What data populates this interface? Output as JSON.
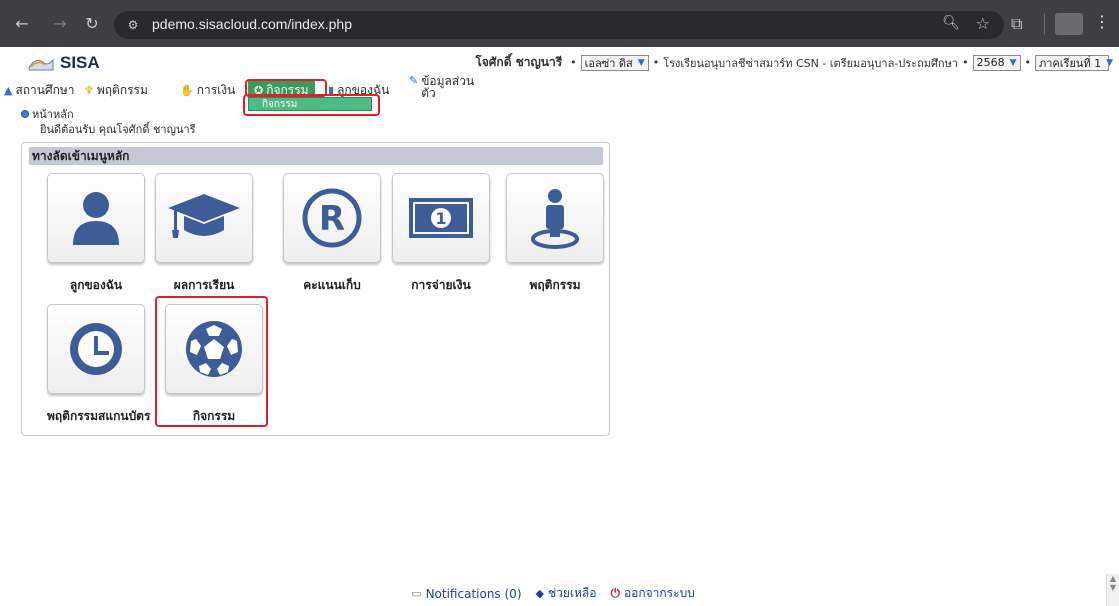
{
  "browser": {
    "url": "pdemo.sisacloud.com/index.php",
    "icons": [
      "back-icon",
      "forward-icon",
      "reload-icon",
      "site-info-icon",
      "zoom-icon",
      "bookmark-star-icon",
      "extensions-icon",
      "more-icon"
    ]
  },
  "header": {
    "app_name": "SISA",
    "user_name": "โจศักดิ์ ชาญนารี",
    "child_select": "เอลซ่า ดิส",
    "school": "โรงเรียนอนุบาลชีซ่าสมาร์ท CSN - เตรียมอนุบาล-ประถมศึกษา",
    "year_select": "2568",
    "term_select": "ภาคเรียนที่ 1"
  },
  "menu": {
    "items": [
      {
        "label": "สถานศึกษา",
        "icon": "school-icon"
      },
      {
        "label": "พฤติกรรม",
        "icon": "behavior-icon"
      },
      {
        "label": "การเงิน",
        "icon": "money-icon"
      },
      {
        "label": "กิจกรรม",
        "icon": "soccer-icon"
      },
      {
        "label": "ลูกของฉัน",
        "icon": "child-icon"
      },
      {
        "label": "ข้อมูลส่วนตัว",
        "icon": "profile-icon"
      }
    ],
    "dropdown_item": "กิจกรรม"
  },
  "breadcrumb": {
    "home": "หน้าหลัก",
    "welcome": "ยินดีต้อนรับ คุณโจศักดิ์ ชาญนารี"
  },
  "panel": {
    "title": "ทางลัดเข้าเมนูหลัก",
    "tiles": [
      {
        "label": "ลูกของฉัน",
        "icon": "person-icon"
      },
      {
        "label": "ผลการเรียน",
        "icon": "graduation-cap-icon"
      },
      {
        "label": "คะแนนเก็บ",
        "icon": "registered-icon"
      },
      {
        "label": "การจ่ายเงิน",
        "icon": "banknote-icon"
      },
      {
        "label": "พฤติกรรม",
        "icon": "person-pin-icon"
      },
      {
        "label": "พฤติกรรมสแกนบัตร",
        "icon": "clock-icon"
      },
      {
        "label": "กิจกรรม",
        "icon": "soccer-ball-icon"
      }
    ]
  },
  "footer": {
    "notifications": "Notifications (0)",
    "help": "ช่วยเหลือ",
    "logout": "ออกจากระบบ"
  },
  "colors": {
    "chrome_bg": "#3c3f44",
    "icon_blue": "#3e5c98",
    "active_menu": "#3a9a5c",
    "highlight": "#e01f26"
  }
}
